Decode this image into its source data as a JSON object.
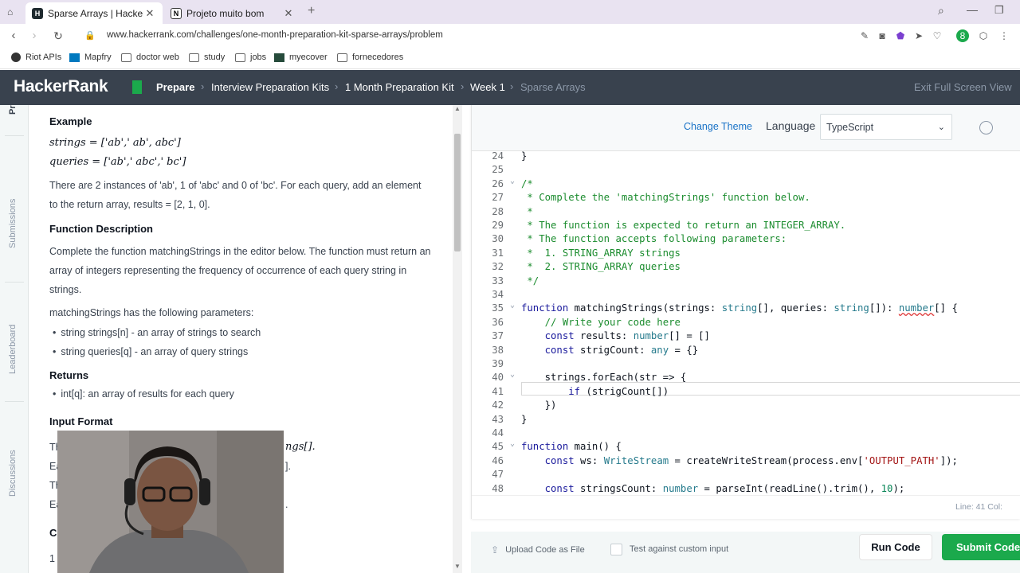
{
  "browser": {
    "tabs": [
      {
        "title": "Sparse Arrays | HackerRank",
        "favicon": "HR"
      },
      {
        "title": "Projeto muito bom",
        "favicon": "N"
      }
    ],
    "url": "www.hackerrank.com/challenges/one-month-preparation-kit-sparse-arrays/problem",
    "bookmarks": [
      "Riot APIs",
      "Mapfry",
      "doctor web",
      "study",
      "jobs",
      "myecover",
      "fornecedores"
    ]
  },
  "header": {
    "logo": "HackerRank",
    "breadcrumbs": [
      "Prepare",
      "Interview Preparation Kits",
      "1 Month Preparation Kit",
      "Week 1",
      "Sparse Arrays"
    ],
    "exit_label": "Exit Full Screen View"
  },
  "side_tabs": {
    "submissions": "Submissions",
    "leaderboard": "Leaderboard",
    "discussions": "Discussions",
    "problem_partial": "Pr"
  },
  "problem": {
    "example_heading": "Example",
    "strings_eq": "strings = ['ab',' ab', abc']",
    "queries_eq": "queries = ['ab',' abc',' bc']",
    "instances_text_1": "There are 2 instances of 'ab', 1 of 'abc' and 0 of 'bc'. For each query, add an element",
    "instances_text_2": "to the return array, results = [2, 1, 0].",
    "func_desc_heading": "Function Description",
    "func_desc_text": "Complete the function matchingStrings in the editor below. The function must return an array of integers representing the frequency of occurrence of each query string in strings.",
    "params_text": "matchingStrings has the following parameters:",
    "params": [
      "string strings[n] - an array of strings to search",
      "string queries[q] - an array of query strings"
    ],
    "returns_heading": "Returns",
    "returns": [
      "int[q]: an array of results for each query"
    ],
    "input_heading": "Input Format",
    "partial_lines": [
      "Th",
      "Ea",
      "Th",
      "Ea"
    ],
    "partial_right": [
      "ngs[].",
      "].",
      "",
      "."
    ],
    "constraints_partial": "Co",
    "one_partial": "1"
  },
  "editor": {
    "change_theme": "Change Theme",
    "language_label": "Language",
    "language_value": "TypeScript",
    "line_col": "Line: 41 Col:",
    "code_lines": [
      {
        "n": "24",
        "html": "}"
      },
      {
        "n": "25",
        "html": ""
      },
      {
        "n": "26",
        "html": "<span class=\"cm\">/*</span>"
      },
      {
        "n": "27",
        "html": "<span class=\"cm\"> * Complete the 'matchingStrings' function below.</span>"
      },
      {
        "n": "28",
        "html": "<span class=\"cm\"> *</span>"
      },
      {
        "n": "29",
        "html": "<span class=\"cm\"> * The function is expected to return an INTEGER_ARRAY.</span>"
      },
      {
        "n": "30",
        "html": "<span class=\"cm\"> * The function accepts following parameters:</span>"
      },
      {
        "n": "31",
        "html": "<span class=\"cm\"> *  1. STRING_ARRAY strings</span>"
      },
      {
        "n": "32",
        "html": "<span class=\"cm\"> *  2. STRING_ARRAY queries</span>"
      },
      {
        "n": "33",
        "html": "<span class=\"cm\"> */</span>"
      },
      {
        "n": "34",
        "html": ""
      },
      {
        "n": "35",
        "html": "<span class=\"kw\">function</span> matchingStrings(strings: <span class=\"ty\">string</span>[], queries: <span class=\"ty\">string</span>[]): <span class=\"ty sq\">number</span>[] {"
      },
      {
        "n": "36",
        "html": "    <span class=\"cm\">// Write your code here</span>"
      },
      {
        "n": "37",
        "html": "    <span class=\"kw\">const</span> results: <span class=\"ty\">number</span>[] = []"
      },
      {
        "n": "38",
        "html": "    <span class=\"kw\">const</span> strigCount: <span class=\"ty\">any</span> = {}"
      },
      {
        "n": "39",
        "html": ""
      },
      {
        "n": "40",
        "html": "    strings.forEach(str => {"
      },
      {
        "n": "41",
        "html": "        <span class=\"kw\">if</span> (strigCount[])"
      },
      {
        "n": "42",
        "html": "    })"
      },
      {
        "n": "43",
        "html": "}"
      },
      {
        "n": "44",
        "html": ""
      },
      {
        "n": "45",
        "html": "<span class=\"kw\">function</span> main() {"
      },
      {
        "n": "46",
        "html": "    <span class=\"kw\">const</span> ws: <span class=\"ty\">WriteStream</span> = createWriteStream(process.env[<span class=\"st\">'OUTPUT_PATH'</span>]);"
      },
      {
        "n": "47",
        "html": ""
      },
      {
        "n": "48",
        "html": "    <span class=\"kw\">const</span> stringsCount: <span class=\"ty\">number</span> = parseInt(readLine().trim(), <span class=\"nu\">10</span>);"
      }
    ],
    "fold_lines": [
      "26",
      "35",
      "40",
      "45"
    ]
  },
  "bottom": {
    "upload": "Upload Code as File",
    "custom_input": "Test against custom input",
    "run": "Run Code",
    "submit": "Submit Code"
  }
}
